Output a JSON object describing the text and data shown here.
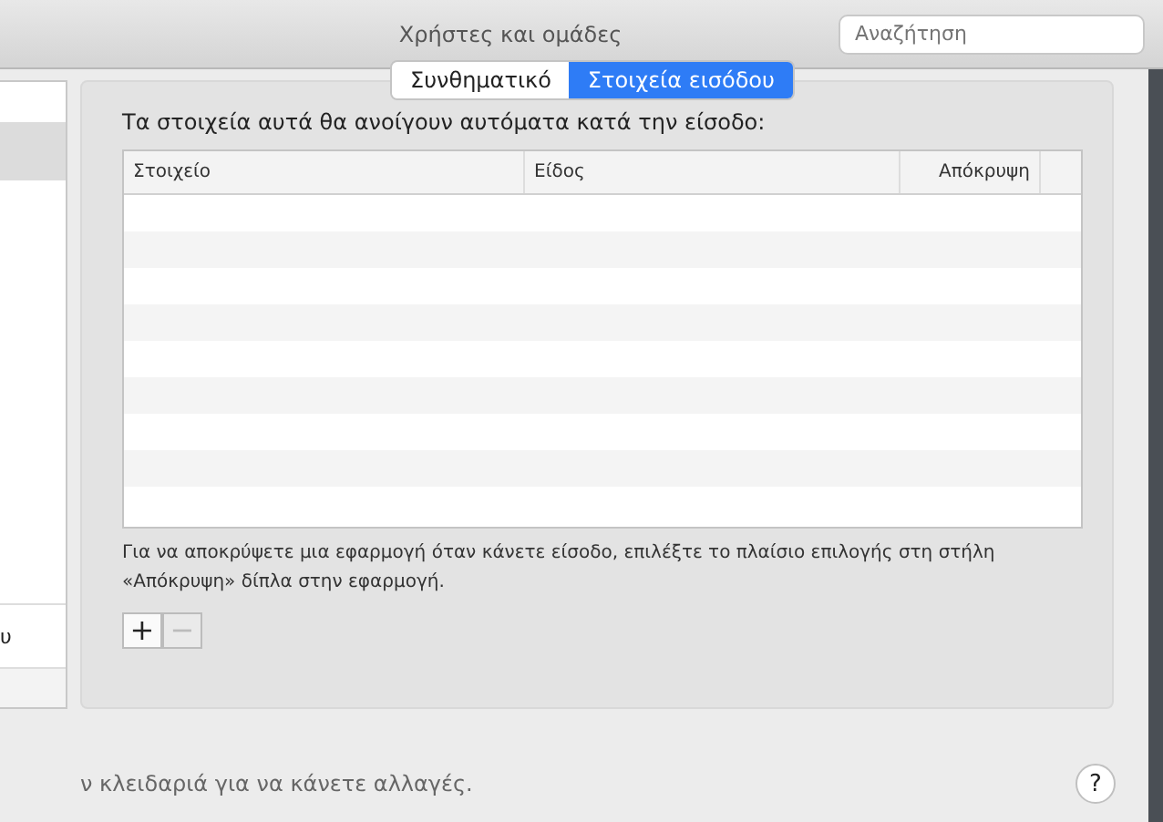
{
  "window": {
    "title": "Χρήστες και ομάδες"
  },
  "search": {
    "placeholder": "Αναζήτηση"
  },
  "sidebar": {
    "items": [
      {
        "selected": true
      },
      {
        "label": "υ",
        "selected": false
      }
    ]
  },
  "tabs": [
    {
      "label": "Συνθηματικό",
      "selected": false
    },
    {
      "label": "Στοιχεία εισόδου",
      "selected": true
    }
  ],
  "intro": "Τα στοιχεία αυτά θα ανοίγουν αυτόματα κατά την είσοδο:",
  "table": {
    "columns": [
      "Στοιχείο",
      "Είδος",
      "Απόκρυψη"
    ]
  },
  "hint": "Για να αποκρύψετε μια εφαρμογή όταν κάνετε είσοδο, επιλέξτε το πλαίσιο επιλογής στη στήλη «Απόκρυψη» δίπλα στην εφαρμογή.",
  "buttons": [
    {
      "label": "+",
      "disabled": false
    },
    {
      "label": "−",
      "disabled": true
    }
  ],
  "lock_text": "ν κλειδαριά για να κάνετε αλλαγές.",
  "help": "?"
}
